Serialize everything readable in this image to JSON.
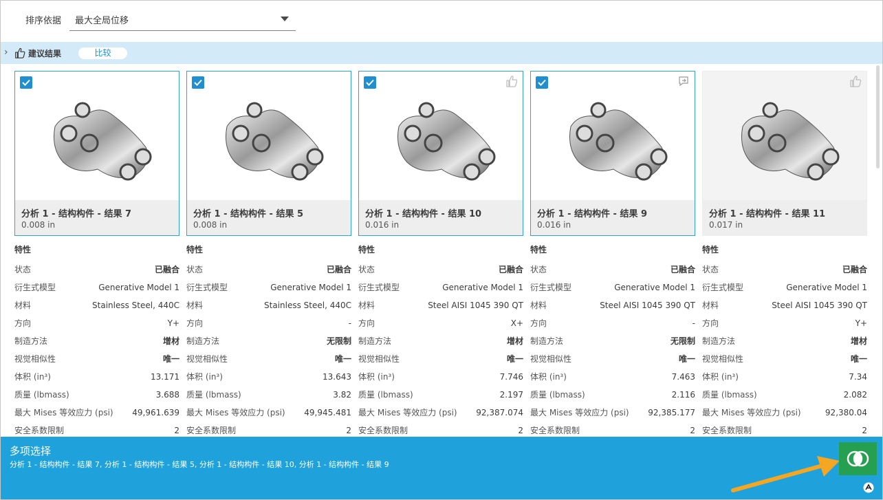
{
  "sort": {
    "label": "排序依据",
    "value": "最大全局位移"
  },
  "suggestion": {
    "title": "建议结果",
    "compare_label": "比较"
  },
  "properties_header": "特性",
  "cards": [
    {
      "title": "分析 1 - 结构构件 - 结果 7",
      "sub": "0.008 in",
      "checked": true,
      "corner_icon": "none",
      "props": [
        {
          "key": "状态",
          "val": "已融合"
        },
        {
          "key": "衍生式模型",
          "val": "Generative Model 1"
        },
        {
          "key": "材料",
          "val": "Stainless Steel, 440C"
        },
        {
          "key": "方向",
          "val": "Y+"
        },
        {
          "key": "制造方法",
          "val": "增材"
        },
        {
          "key": "视觉相似性",
          "val": "唯一"
        },
        {
          "key": "体积 (in³)",
          "val": "13.171"
        },
        {
          "key": "质量 (lbmass)",
          "val": "3.688"
        },
        {
          "key": "最大 Mises 等效应力 (psi)",
          "val": "49,961.639"
        },
        {
          "key": "安全系数限制",
          "val": "2"
        }
      ]
    },
    {
      "title": "分析 1 - 结构构件 - 结果 5",
      "sub": "0.008 in",
      "checked": true,
      "corner_icon": "none",
      "props": [
        {
          "key": "状态",
          "val": "已融合"
        },
        {
          "key": "衍生式模型",
          "val": "Generative Model 1"
        },
        {
          "key": "材料",
          "val": "Stainless Steel, 440C"
        },
        {
          "key": "方向",
          "val": "-"
        },
        {
          "key": "制造方法",
          "val": "无限制"
        },
        {
          "key": "视觉相似性",
          "val": "唯一"
        },
        {
          "key": "体积 (in³)",
          "val": "13.643"
        },
        {
          "key": "质量 (lbmass)",
          "val": "3.82"
        },
        {
          "key": "最大 Mises 等效应力 (psi)",
          "val": "49,945.481"
        },
        {
          "key": "安全系数限制",
          "val": "2"
        }
      ]
    },
    {
      "title": "分析 1 - 结构构件 - 结果 10",
      "sub": "0.016 in",
      "checked": true,
      "corner_icon": "thumbs-up-icon",
      "props": [
        {
          "key": "状态",
          "val": "已融合"
        },
        {
          "key": "衍生式模型",
          "val": "Generative Model 1"
        },
        {
          "key": "材料",
          "val": "Steel AISI 1045 390 QT"
        },
        {
          "key": "方向",
          "val": "X+"
        },
        {
          "key": "制造方法",
          "val": "增材"
        },
        {
          "key": "视觉相似性",
          "val": "唯一"
        },
        {
          "key": "体积 (in³)",
          "val": "7.746"
        },
        {
          "key": "质量 (lbmass)",
          "val": "2.197"
        },
        {
          "key": "最大 Mises 等效应力 (psi)",
          "val": "92,387.074"
        },
        {
          "key": "安全系数限制",
          "val": "2"
        }
      ]
    },
    {
      "title": "分析 1 - 结构构件 - 结果 9",
      "sub": "0.016 in",
      "checked": true,
      "corner_icon": "export-icon",
      "props": [
        {
          "key": "状态",
          "val": "已融合"
        },
        {
          "key": "衍生式模型",
          "val": "Generative Model 1"
        },
        {
          "key": "材料",
          "val": "Steel AISI 1045 390 QT"
        },
        {
          "key": "方向",
          "val": "-"
        },
        {
          "key": "制造方法",
          "val": "无限制"
        },
        {
          "key": "视觉相似性",
          "val": "唯一"
        },
        {
          "key": "体积 (in³)",
          "val": "7.463"
        },
        {
          "key": "质量 (lbmass)",
          "val": "2.116"
        },
        {
          "key": "最大 Mises 等效应力 (psi)",
          "val": "92,385.177"
        },
        {
          "key": "安全系数限制",
          "val": "2"
        }
      ]
    },
    {
      "title": "分析 1 - 结构构件 - 结果 11",
      "sub": "0.017 in",
      "checked": false,
      "corner_icon": "thumbs-up-icon",
      "props": [
        {
          "key": "状态",
          "val": "已融合"
        },
        {
          "key": "衍生式模型",
          "val": "Generative Model 1"
        },
        {
          "key": "材料",
          "val": "Steel AISI 1045 390 QT"
        },
        {
          "key": "方向",
          "val": "Y+"
        },
        {
          "key": "制造方法",
          "val": "增材"
        },
        {
          "key": "视觉相似性",
          "val": "唯一"
        },
        {
          "key": "体积 (in³)",
          "val": "7.34"
        },
        {
          "key": "质量 (lbmass)",
          "val": "2.082"
        },
        {
          "key": "最大 Mises 等效应力 (psi)",
          "val": "92,380.04"
        },
        {
          "key": "安全系数限制",
          "val": "2"
        }
      ]
    }
  ],
  "bottom": {
    "title": "多项选择",
    "selection": "分析 1 - 结构构件 - 结果 7, 分析 1 - 结构构件 - 结果 5, 分析 1 - 结构构件 - 结果 10, 分析 1 - 结构构件 - 结果 9"
  },
  "colors": {
    "accent": "#1fa2dc",
    "compare_green": "#25a050",
    "arrow": "#f5a623"
  }
}
